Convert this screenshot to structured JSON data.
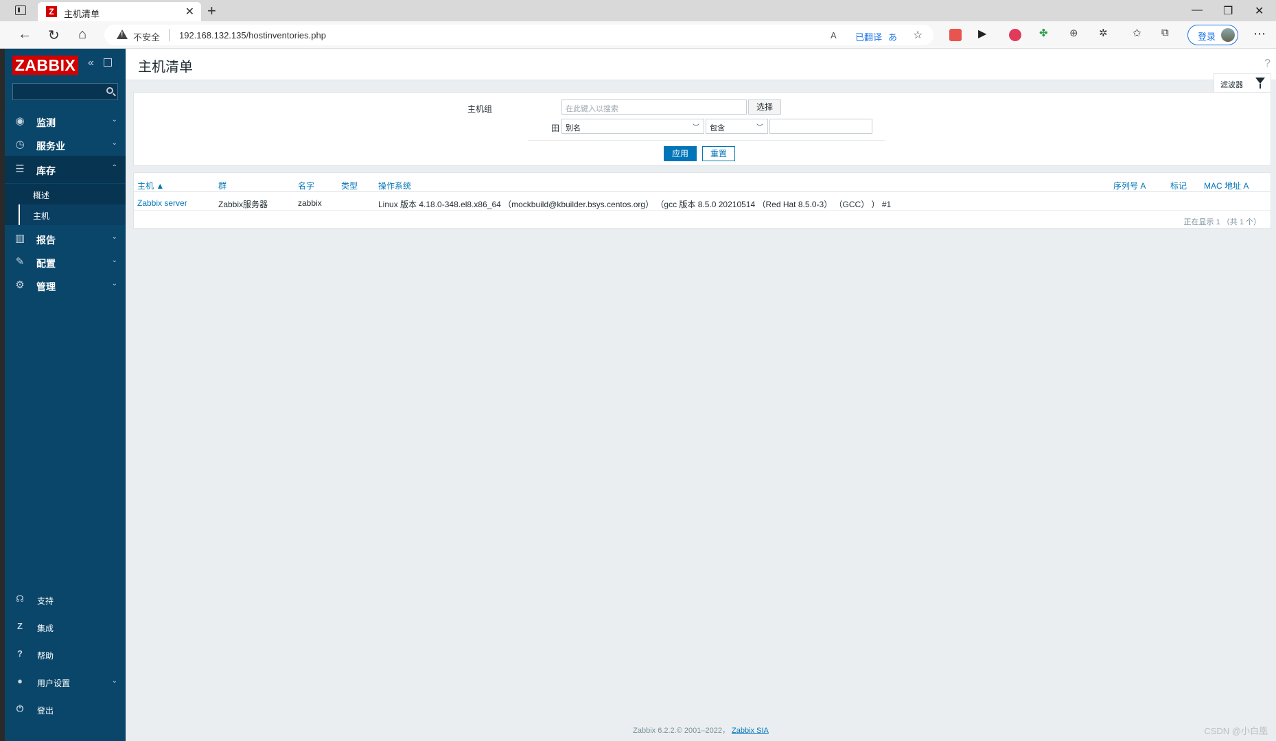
{
  "browser": {
    "tab_title": "主机清单",
    "tab_favicon": "Z",
    "insecure_label": "不安全",
    "url": "192.168.132.135/hostinventories.php",
    "read_aloud": "A",
    "translated_label": "已翻译",
    "translate_glyph": "あ",
    "login_label": "登录"
  },
  "sidebar": {
    "logo": "ZABBIX",
    "menu": [
      {
        "label": "监测",
        "icon": "eye-icon"
      },
      {
        "label": "服务业",
        "icon": "clock-icon"
      },
      {
        "label": "库存",
        "icon": "list-icon"
      },
      {
        "label": "报告",
        "icon": "chart-icon"
      },
      {
        "label": "配置",
        "icon": "wrench-icon"
      },
      {
        "label": "管理",
        "icon": "gear-icon"
      }
    ],
    "submenu": [
      {
        "label": "概述"
      },
      {
        "label": "主机"
      }
    ],
    "bottom": [
      {
        "label": "支持",
        "icon": "headset-icon"
      },
      {
        "label": "集成",
        "icon": "zabbix-z-icon"
      },
      {
        "label": "帮助",
        "icon": "question-icon"
      },
      {
        "label": "用户设置",
        "icon": "user-icon"
      },
      {
        "label": "登出",
        "icon": "power-icon"
      }
    ]
  },
  "header": {
    "title": "主机清单",
    "help": "?"
  },
  "filter": {
    "tab_label": "滤波器",
    "host_group_label": "主机组",
    "host_group_placeholder": "在此键入以搜索",
    "select_button": "选择",
    "field_icon": "田",
    "field_select": "别名",
    "operator_select": "包含",
    "field_value": "",
    "apply_button": "应用",
    "reset_button": "重置"
  },
  "table": {
    "columns": [
      "主机 ▲",
      "群",
      "名字",
      "类型",
      "操作系统",
      "序列号 A",
      "标记",
      "MAC 地址 A"
    ],
    "rows": [
      {
        "host": "Zabbix server",
        "group": "Zabbix服务器",
        "name": "zabbix",
        "type": "",
        "os": "Linux 版本 4.18.0-348.el8.x86_64 （mockbuild@kbuilder.bsys.centos.org） （gcc 版本 8.5.0 20210514 （Red Hat 8.5.0-3） （GCC） ） #1",
        "serial": "",
        "tag": "",
        "mac": ""
      }
    ],
    "paging": "正在显示 1 （共 1 个）"
  },
  "footer": {
    "text": "Zabbix 6.2.2.© 2001–2022，",
    "link": "Zabbix SIA"
  },
  "watermark": "CSDN @小白凰",
  "colors": {
    "sidebar_bg": "#0a466a",
    "accent": "#0275b8",
    "logo_red": "#d40000"
  }
}
